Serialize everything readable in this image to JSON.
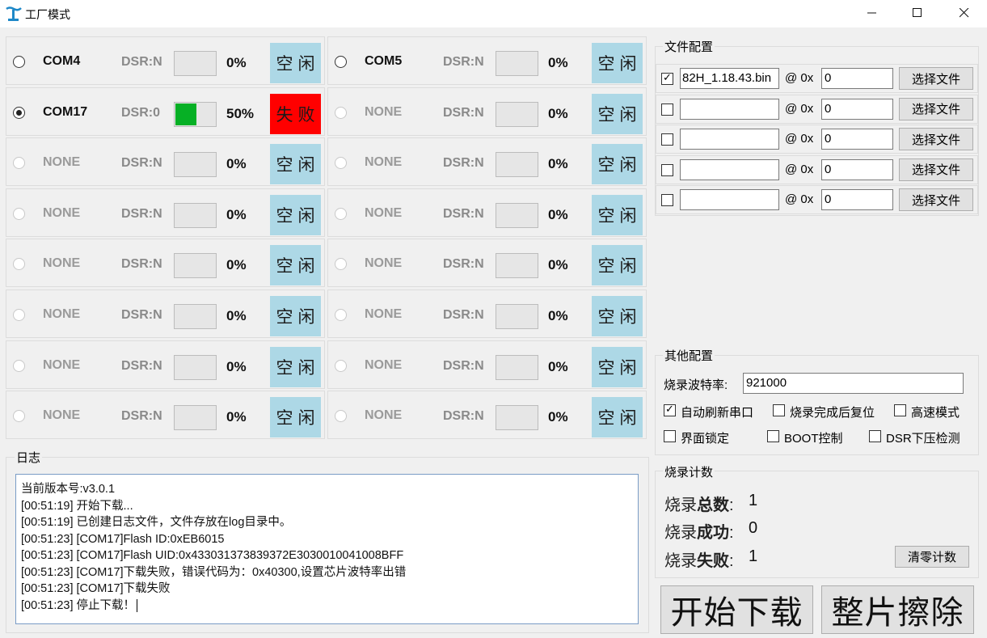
{
  "window": {
    "title": "工厂模式",
    "min_glyph": "—",
    "max_glyph": "☐",
    "close_glyph": "✕"
  },
  "ports": [
    {
      "name": "COM4",
      "dsr": "DSR:N",
      "pct": "0%",
      "progress": 0,
      "status": "空闲",
      "state": "idle",
      "selected": false,
      "enabled": true
    },
    {
      "name": "COM5",
      "dsr": "DSR:N",
      "pct": "0%",
      "progress": 0,
      "status": "空闲",
      "state": "idle",
      "selected": false,
      "enabled": true
    },
    {
      "name": "COM17",
      "dsr": "DSR:0",
      "pct": "50%",
      "progress": 0.5,
      "status": "失败",
      "state": "fail",
      "selected": true,
      "enabled": true
    },
    {
      "name": "NONE",
      "dsr": "DSR:N",
      "pct": "0%",
      "progress": 0,
      "status": "空闲",
      "state": "idle",
      "selected": false,
      "enabled": false
    },
    {
      "name": "NONE",
      "dsr": "DSR:N",
      "pct": "0%",
      "progress": 0,
      "status": "空闲",
      "state": "idle",
      "selected": false,
      "enabled": false
    },
    {
      "name": "NONE",
      "dsr": "DSR:N",
      "pct": "0%",
      "progress": 0,
      "status": "空闲",
      "state": "idle",
      "selected": false,
      "enabled": false
    },
    {
      "name": "NONE",
      "dsr": "DSR:N",
      "pct": "0%",
      "progress": 0,
      "status": "空闲",
      "state": "idle",
      "selected": false,
      "enabled": false
    },
    {
      "name": "NONE",
      "dsr": "DSR:N",
      "pct": "0%",
      "progress": 0,
      "status": "空闲",
      "state": "idle",
      "selected": false,
      "enabled": false
    },
    {
      "name": "NONE",
      "dsr": "DSR:N",
      "pct": "0%",
      "progress": 0,
      "status": "空闲",
      "state": "idle",
      "selected": false,
      "enabled": false
    },
    {
      "name": "NONE",
      "dsr": "DSR:N",
      "pct": "0%",
      "progress": 0,
      "status": "空闲",
      "state": "idle",
      "selected": false,
      "enabled": false
    },
    {
      "name": "NONE",
      "dsr": "DSR:N",
      "pct": "0%",
      "progress": 0,
      "status": "空闲",
      "state": "idle",
      "selected": false,
      "enabled": false
    },
    {
      "name": "NONE",
      "dsr": "DSR:N",
      "pct": "0%",
      "progress": 0,
      "status": "空闲",
      "state": "idle",
      "selected": false,
      "enabled": false
    },
    {
      "name": "NONE",
      "dsr": "DSR:N",
      "pct": "0%",
      "progress": 0,
      "status": "空闲",
      "state": "idle",
      "selected": false,
      "enabled": false
    },
    {
      "name": "NONE",
      "dsr": "DSR:N",
      "pct": "0%",
      "progress": 0,
      "status": "空闲",
      "state": "idle",
      "selected": false,
      "enabled": false
    },
    {
      "name": "NONE",
      "dsr": "DSR:N",
      "pct": "0%",
      "progress": 0,
      "status": "空闲",
      "state": "idle",
      "selected": false,
      "enabled": false
    },
    {
      "name": "NONE",
      "dsr": "DSR:N",
      "pct": "0%",
      "progress": 0,
      "status": "空闲",
      "state": "idle",
      "selected": false,
      "enabled": false
    }
  ],
  "log": {
    "title": "日志",
    "lines": [
      "当前版本号:v3.0.1",
      "[00:51:19] 开始下载...",
      "[00:51:19] 已创建日志文件，文件存放在log目录中。",
      "[00:51:23] [COM17]Flash ID:0xEB6015",
      "[00:51:23] [COM17]Flash UID:0x433031373839372E3030010041008BFF",
      "[00:51:23] [COM17]下载失败，错误代码为：0x40300,设置芯片波特率出错",
      "[00:51:23] [COM17]下载失败",
      "[00:51:23] 停止下载！"
    ]
  },
  "file_config": {
    "title": "文件配置",
    "at_label": "@ 0x",
    "choose_label": "选择文件",
    "rows": [
      {
        "checked": true,
        "file": "82H_1.18.43.bin",
        "addr": "0"
      },
      {
        "checked": false,
        "file": "",
        "addr": "0"
      },
      {
        "checked": false,
        "file": "",
        "addr": "0"
      },
      {
        "checked": false,
        "file": "",
        "addr": "0"
      },
      {
        "checked": false,
        "file": "",
        "addr": "0"
      }
    ]
  },
  "other_config": {
    "title": "其他配置",
    "baud_label": "烧录波特率:",
    "baud_value": "921000",
    "options": [
      {
        "label": "自动刷新串口",
        "checked": true
      },
      {
        "label": "烧录完成后复位",
        "checked": false
      },
      {
        "label": "高速模式",
        "checked": false
      },
      {
        "label": "界面锁定",
        "checked": false
      },
      {
        "label": "BOOT控制",
        "checked": false
      },
      {
        "label": "DSR下压检测",
        "checked": false
      }
    ]
  },
  "burn_count": {
    "title": "烧录计数",
    "total_label_a": "烧录",
    "total_label_b": "总数",
    "total_value": "1",
    "success_label_a": "烧录",
    "success_label_b": "成功",
    "success_value": "0",
    "fail_label_a": "烧录",
    "fail_label_b": "失败",
    "fail_value": "1",
    "clear_label": "清零计数"
  },
  "actions": {
    "start_label": "开始下载",
    "erase_label": "整片擦除"
  },
  "colors": {
    "idle": "#add8e6",
    "fail": "#ff0000",
    "progress": "#06b025"
  }
}
